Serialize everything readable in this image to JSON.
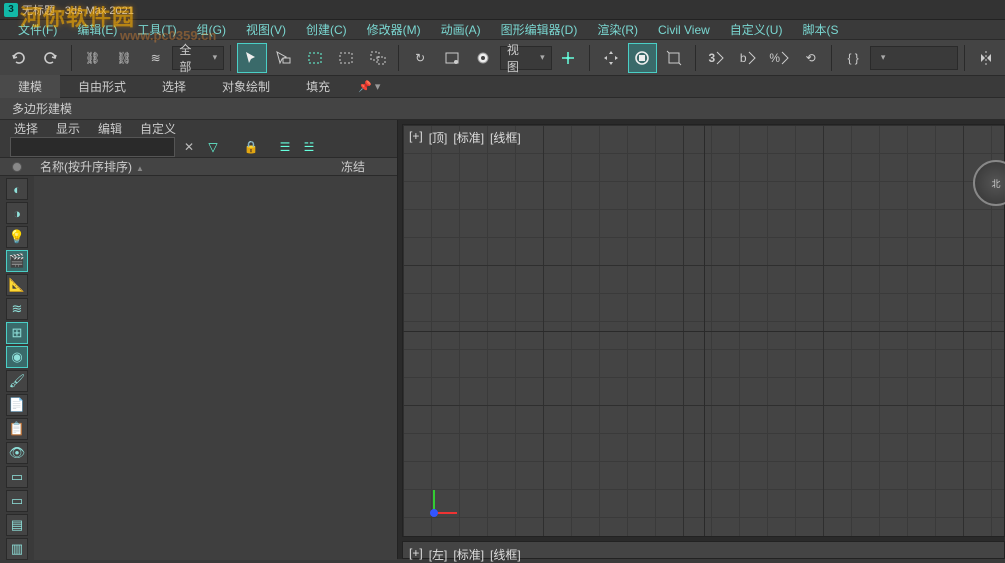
{
  "title": {
    "icon_text": "3",
    "text": "无标题 - 3ds Max 2021"
  },
  "watermark": {
    "main": "河你软件园",
    "sub": "www.pc0359.cn"
  },
  "menu": {
    "items": [
      "文件(F)",
      "编辑(E)",
      "工具(T)",
      "组(G)",
      "视图(V)",
      "创建(C)",
      "修改器(M)",
      "动画(A)",
      "图形编辑器(D)",
      "渲染(R)",
      "Civil View",
      "自定义(U)",
      "脚本(S"
    ]
  },
  "toolbar": {
    "undo": "↶",
    "redo": "↷",
    "link": "⛓",
    "unlink": "⛓",
    "bind": "≋",
    "all_label": "全部",
    "sel_rect": "▭",
    "sel_add": "▭",
    "sel_win": "▢",
    "sel_cross": "▢",
    "sel_fence": "▢",
    "refresh": "↻",
    "region": "▭",
    "orbit": "◉",
    "view_label": "视图",
    "move": "✥",
    "rotate": "⟳",
    "scale": "⤢",
    "place": "⬒",
    "snap3": "3",
    "angle": "b",
    "pct": "%",
    "spinner": "⟲",
    "curly": "{ }",
    "mirror": "⎋",
    "reset": "▼"
  },
  "ribbon": {
    "tabs": [
      "建模",
      "自由形式",
      "选择",
      "对象绘制",
      "填充"
    ],
    "pin": "📌 ▾",
    "sub": "多边形建模"
  },
  "scene_panel": {
    "menu": [
      "选择",
      "显示",
      "编辑",
      "自定义"
    ],
    "search_placeholder": "",
    "icons": {
      "clear": "✕",
      "filter": "▽",
      "lock": "🔒",
      "tree1": "☰",
      "tree2": "☱"
    },
    "header": {
      "name": "名称(按升序排序)",
      "sort": "▲",
      "freeze": "冻结"
    },
    "side_icons": [
      "◐",
      "◑",
      "💡",
      "🎬",
      "📐",
      "≋",
      "⊞",
      "◉",
      "🖌",
      "📄",
      "📋",
      "👁",
      "▭",
      "▭",
      "▤",
      "▥"
    ]
  },
  "viewports": {
    "top": {
      "plus": "[+]",
      "view": "[顶]",
      "shade": "[标准]",
      "mode": "[线框]"
    },
    "left": {
      "plus": "[+]",
      "view": "[左]",
      "shade": "[标准]",
      "mode": "[线框]"
    }
  },
  "chart_data": null
}
